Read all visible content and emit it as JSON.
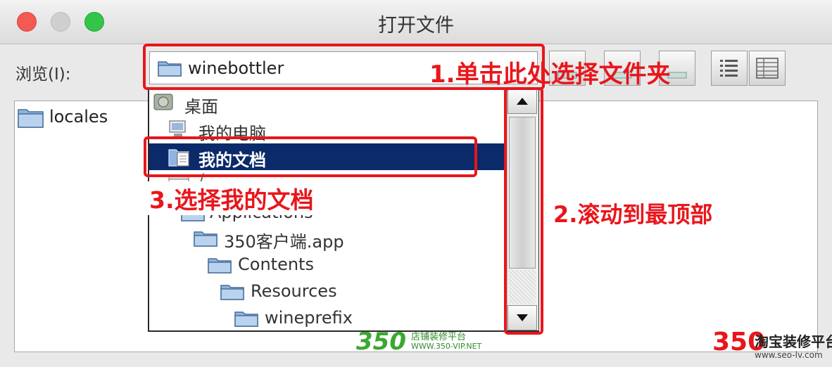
{
  "window": {
    "title": "打开文件"
  },
  "browse": {
    "label": "浏览(I):",
    "current_folder": "winebottler"
  },
  "files": [
    {
      "name": "locales",
      "type": "folder"
    }
  ],
  "dropdown": {
    "items": [
      {
        "label": "桌面",
        "icon": "desktop-icon"
      },
      {
        "label": "我的电脑",
        "icon": "computer-icon"
      },
      {
        "label": "我的文档",
        "icon": "documents-icon",
        "selected": true
      },
      {
        "label": "/",
        "icon": "drive-icon"
      },
      {
        "label": "Applications",
        "icon": "folder-icon"
      },
      {
        "label": "350客户端.app",
        "icon": "folder-icon"
      },
      {
        "label": "Contents",
        "icon": "folder-icon"
      },
      {
        "label": "Resources",
        "icon": "folder-icon"
      },
      {
        "label": "wineprefix",
        "icon": "folder-icon"
      }
    ]
  },
  "annotations": {
    "step1": "1.单击此处选择文件夹",
    "step2": "2.滚动到最顶部",
    "step3": "3.选择我的文档"
  },
  "watermarks": {
    "left_logo": "350",
    "left_line1": "店铺装修平台",
    "left_line2": "WWW.350-VIP.NET",
    "right_logo": "350",
    "right_line1": "淘宝装修平台",
    "right_line2": "www.seo-lv.com"
  },
  "colors": {
    "selection": "#0a2a6a",
    "annotation_red": "#e8161c",
    "close_light": "#f25a53",
    "max_light": "#33c44a",
    "folder_blue": "#8fb4df"
  }
}
